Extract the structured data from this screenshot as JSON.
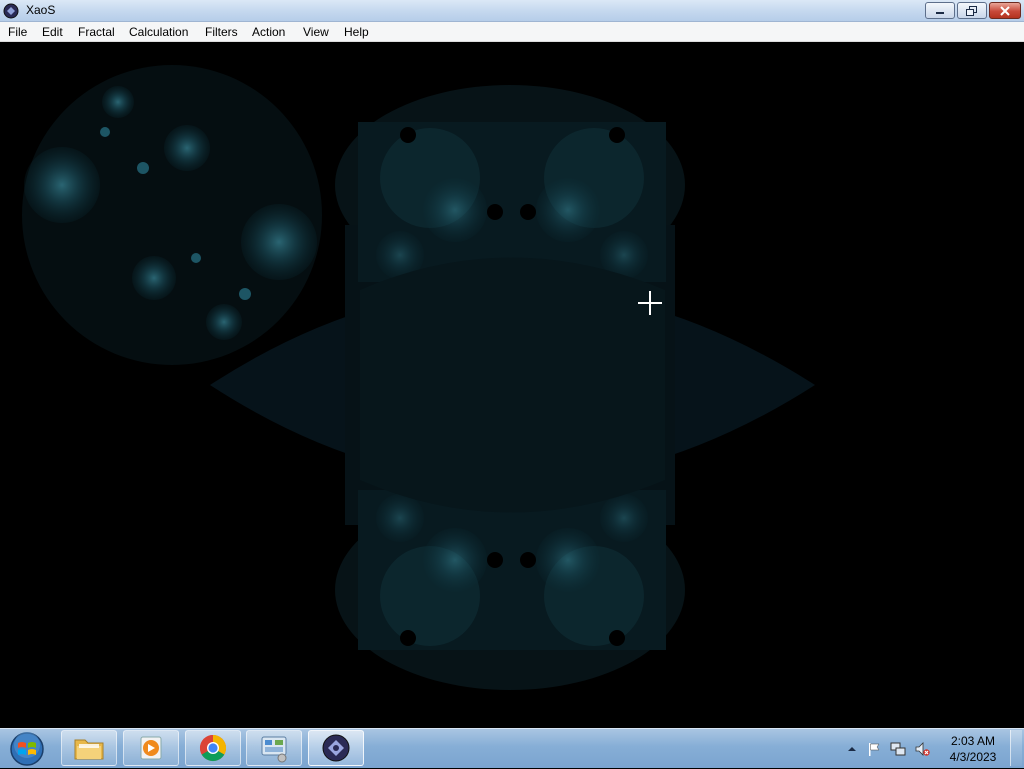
{
  "window": {
    "title": "XaoS",
    "app_icon": "xaos-icon",
    "buttons": {
      "minimize_icon": "minimize-icon",
      "maximize_icon": "restore-icon",
      "close_icon": "close-icon"
    }
  },
  "menubar": {
    "items": [
      "File",
      "Edit",
      "Fractal",
      "Calculation",
      "Filters",
      "Action",
      "View",
      "Help"
    ]
  },
  "canvas": {
    "description_type": "fractal-render",
    "cursor": "crosshair-cursor",
    "palette": {
      "background": "#000000",
      "fractal_dark": "#061418",
      "fractal_glow": "#2e7a8c"
    }
  },
  "taskbar": {
    "start_icon": "windows-start-icon",
    "apps": [
      {
        "name": "file-explorer",
        "icon": "folder-icon"
      },
      {
        "name": "media-player",
        "icon": "media-player-icon"
      },
      {
        "name": "chrome",
        "icon": "chrome-icon"
      },
      {
        "name": "control-panel",
        "icon": "control-panel-icon"
      },
      {
        "name": "xaos",
        "icon": "xaos-icon",
        "active": true
      }
    ],
    "tray": {
      "icons": [
        "show-hidden-icons-arrow",
        "action-center-flag-icon",
        "network-icon",
        "volume-muted-icon"
      ],
      "time": "2:03 AM",
      "date": "4/3/2023"
    }
  }
}
